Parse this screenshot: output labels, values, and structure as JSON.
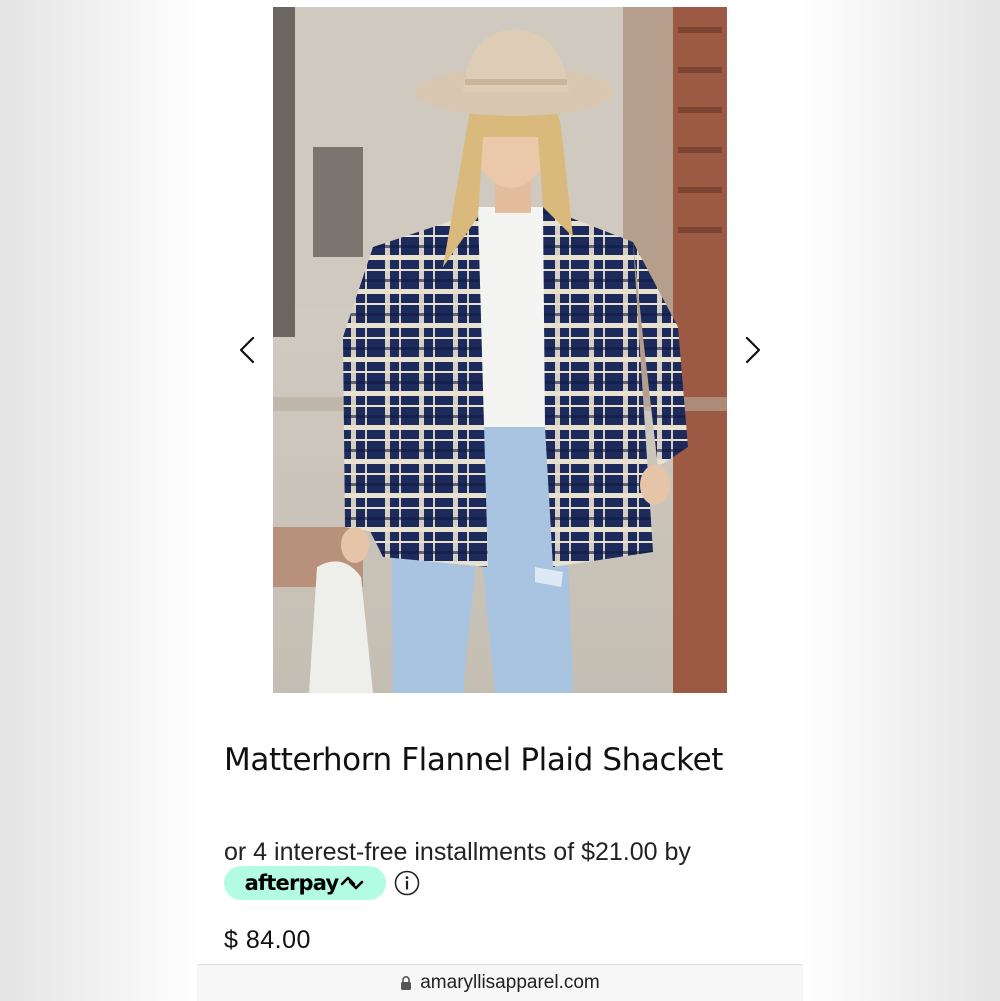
{
  "product": {
    "title": "Matterhorn Flannel Plaid Shacket",
    "installments_text": "or 4 interest-free installments of $21.00 by",
    "afterpay_label": "afterpay",
    "price": "$ 84.00"
  },
  "gallery": {
    "image_alt": "Model wearing navy and cream plaid flannel shacket with light wash jeans and tan hat"
  },
  "browser": {
    "url": "amaryllisapparel.com"
  },
  "colors": {
    "afterpay_mint": "#b2fce4",
    "plaid_navy": "#1d2a5c",
    "plaid_cream": "#e9e2d0",
    "denim": "#a9c4e0"
  },
  "icons": {
    "prev": "chevron-left-icon",
    "next": "chevron-right-icon",
    "info": "info-icon",
    "lock": "lock-icon",
    "afterpay_logo": "afterpay-arrows-icon"
  }
}
